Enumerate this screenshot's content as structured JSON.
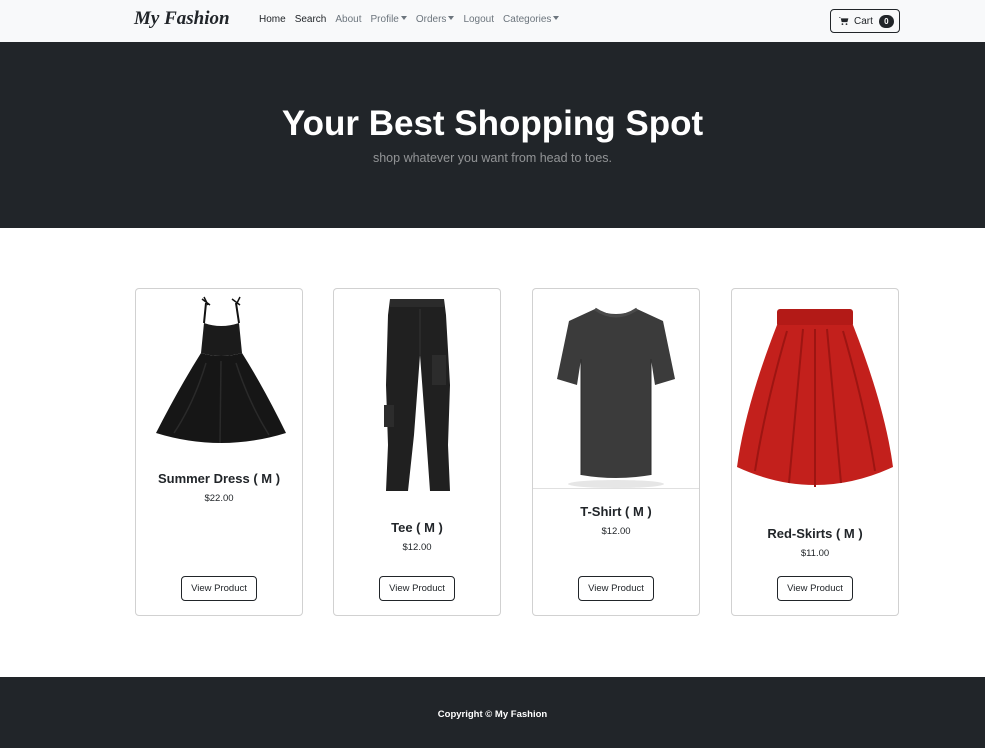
{
  "navbar": {
    "brand": "My Fashion",
    "links": {
      "home": "Home",
      "search": "Search",
      "about": "About",
      "profile": "Profile",
      "orders": "Orders",
      "logout": "Logout",
      "categories": "Categories"
    },
    "cart": {
      "label": "Cart",
      "count": "0",
      "icon": "cart-icon"
    }
  },
  "hero": {
    "title": "Your Best Shopping Spot",
    "subtitle": "shop whatever you want from head to toes."
  },
  "products": [
    {
      "name": "Summer Dress ( M )",
      "price": "$22.00",
      "button": "View Product",
      "image": "black-dress-image"
    },
    {
      "name": "Tee ( M )",
      "price": "$12.00",
      "button": "View Product",
      "image": "black-pants-image"
    },
    {
      "name": "T-Shirt ( M )",
      "price": "$12.00",
      "button": "View Product",
      "image": "gray-tshirt-image"
    },
    {
      "name": "Red-Skirts ( M )",
      "price": "$11.00",
      "button": "View Product",
      "image": "red-skirt-image"
    }
  ],
  "footer": {
    "text": "Copyright © My Fashion"
  },
  "colors": {
    "dark": "#212529",
    "navbar_bg": "#f8f9fa",
    "muted": "#6c757d",
    "skirt_red": "#c3201c"
  }
}
